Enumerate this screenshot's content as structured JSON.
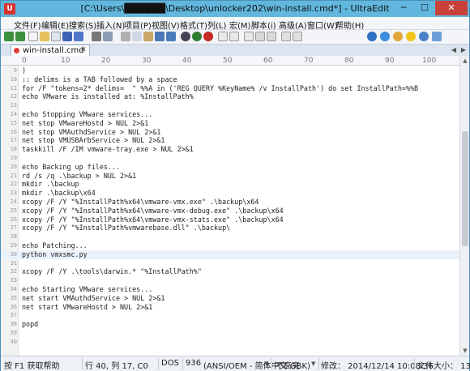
{
  "window": {
    "title": "[C:\\Users\\██████\\Desktop\\unlocker202\\win-install.cmd*] - UltraEdit",
    "app_icon_letter": "U",
    "minimize_glyph": "─",
    "maximize_glyph": "☐",
    "close_glyph": "✕"
  },
  "menubar": {
    "items": [
      "文件(F)",
      "编辑(E)",
      "搜索(S)",
      "插入(N)",
      "项目(P)",
      "视图(V)",
      "格式(T)",
      "列(L)",
      "宏(M)",
      "脚本(i)",
      "高级(A)",
      "窗口(W)",
      "帮助(H)"
    ]
  },
  "toolbar": {
    "icons": [
      "arrow-left-icon",
      "arrow-right-icon",
      "new-file-icon",
      "open-folder-icon",
      "close-file-icon",
      "save-icon",
      "save-all-icon",
      "print-icon",
      "print-preview-icon",
      "cut-icon",
      "copy-icon",
      "paste-icon",
      "undo-icon",
      "redo-icon",
      "column-mode-icon",
      "find-icon",
      "replace-icon",
      "hex-icon",
      "word-wrap-icon",
      "spell-check-icon",
      "browser-icon",
      "ftp-icon",
      "settings-icon",
      "help-icon",
      "info-icon",
      "lightbulb-icon",
      "user-icon",
      "star-icon"
    ]
  },
  "tab": {
    "label": "win-install.cmd",
    "close_glyph": "✕",
    "scroll_left": "◀",
    "scroll_right": "▶"
  },
  "ruler": {
    "marks": [
      "0",
      "10",
      "20",
      "30",
      "40",
      "50",
      "60",
      "70",
      "80",
      "90",
      "100"
    ]
  },
  "editor": {
    "lines": [
      {
        "n": "9",
        "t": ")"
      },
      {
        "n": "10",
        "t": ":: delims is a TAB followed by a space"
      },
      {
        "n": "11",
        "t": "for /F \"tokens=2* delims=  \" %%A in ('REG QUERY %KeyName% /v InstallPath') do set InstallPath=%%B"
      },
      {
        "n": "12",
        "t": "echo VMware is installed at: %InstallPath%"
      },
      {
        "n": "13",
        "t": ""
      },
      {
        "n": "14",
        "t": "echo Stopping VMware services..."
      },
      {
        "n": "15",
        "t": "net stop VMwareHostd > NUL 2>&1"
      },
      {
        "n": "16",
        "t": "net stop VMAuthdService > NUL 2>&1"
      },
      {
        "n": "17",
        "t": "net stop VMUSBArbService > NUL 2>&1"
      },
      {
        "n": "18",
        "t": "taskkill /F /IM vmware-tray.exe > NUL 2>&1"
      },
      {
        "n": "19",
        "t": ""
      },
      {
        "n": "20",
        "t": "echo Backing up files..."
      },
      {
        "n": "21",
        "t": "rd /s /q .\\backup > NUL 2>&1"
      },
      {
        "n": "22",
        "t": "mkdir .\\backup"
      },
      {
        "n": "23",
        "t": "mkdir .\\backup\\x64"
      },
      {
        "n": "24",
        "t": "xcopy /F /Y \"%InstallPath%x64\\vmware-vmx.exe\" .\\backup\\x64"
      },
      {
        "n": "25",
        "t": "xcopy /F /Y \"%InstallPath%x64\\vmware-vmx-debug.exe\" .\\backup\\x64"
      },
      {
        "n": "26",
        "t": "xcopy /F /Y \"%InstallPath%x64\\vmware-vmx-stats.exe\" .\\backup\\x64"
      },
      {
        "n": "27",
        "t": "xcopy /F /Y \"%InstallPath%vmwarebase.dll\" .\\backup\\"
      },
      {
        "n": "28",
        "t": ""
      },
      {
        "n": "29",
        "t": "echo Patching..."
      },
      {
        "n": "30",
        "t": "python vmxsmc.py"
      },
      {
        "n": "31",
        "t": ""
      },
      {
        "n": "32",
        "t": "xcopy /F /Y .\\tools\\darwin.* \"%InstallPath%\""
      },
      {
        "n": "33",
        "t": ""
      },
      {
        "n": "34",
        "t": "echo Starting VMware services..."
      },
      {
        "n": "35",
        "t": "net start VMAuthdService > NUL 2>&1"
      },
      {
        "n": "36",
        "t": "net start VMwareHostd > NUL 2>&1"
      },
      {
        "n": "37",
        "t": ""
      },
      {
        "n": "38",
        "t": "popd"
      },
      {
        "n": "39",
        "t": ""
      },
      {
        "n": "40",
        "t": ""
      }
    ],
    "highlight_index": 21
  },
  "scrollbar": {
    "up": "▲",
    "down": "▼"
  },
  "status": {
    "help": "按 F1 获取帮助",
    "position": "行 40, 列 17, C0",
    "line_ending": "DOS",
    "codepage": "936",
    "encoding": "(ANSI/OEM - 简体中文 GBK)",
    "highlight": "不高亮",
    "modified": "修改：  2014/12/14 10:08:36",
    "filesize": "文件大小：  13",
    "dropdown_glyph": "▼"
  },
  "colors": {
    "titlebar": "#61b7dd",
    "close_button": "#c9423a",
    "editor_bg": "#ffffff",
    "current_line": "#e9f2fb"
  }
}
